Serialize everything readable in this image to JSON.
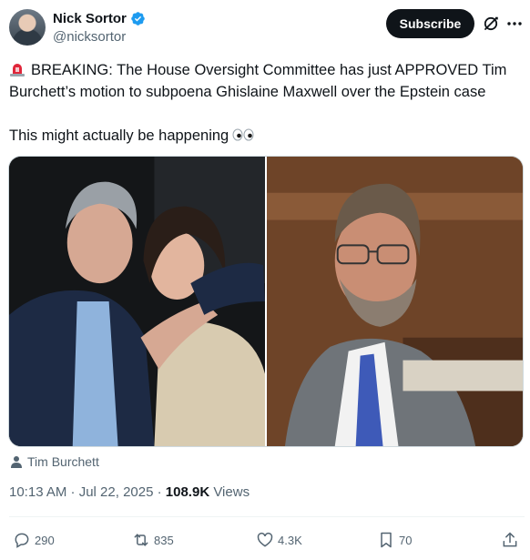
{
  "author": {
    "display_name": "Nick Sortor",
    "handle": "@nicksortor",
    "verified": true
  },
  "header": {
    "subscribe_label": "Subscribe",
    "icons": [
      "grok-icon",
      "more-icon"
    ]
  },
  "tweet": {
    "line1": "BREAKING: The House Oversight Committee has just APPROVED Tim Burchett’s motion to subpoena Ghislaine Maxwell over the Epstein case",
    "line2": "This might actually be happening",
    "emoji_start": "rotating-light-icon",
    "emoji_end": "eyes-icon"
  },
  "media": {
    "tagged_person": "Tim Burchett"
  },
  "meta": {
    "timestamp": "10:13 AM · Jul 22, 2025",
    "separator": "·",
    "views_count": "108.9K",
    "views_label": "Views"
  },
  "actions": {
    "reply_count": "290",
    "repost_count": "835",
    "like_count": "4.3K",
    "bookmark_count": "70"
  },
  "colors": {
    "text": "#0f1419",
    "secondary": "#536471",
    "verified": "#1d9bf0",
    "subscribe_bg": "#0f1419"
  }
}
